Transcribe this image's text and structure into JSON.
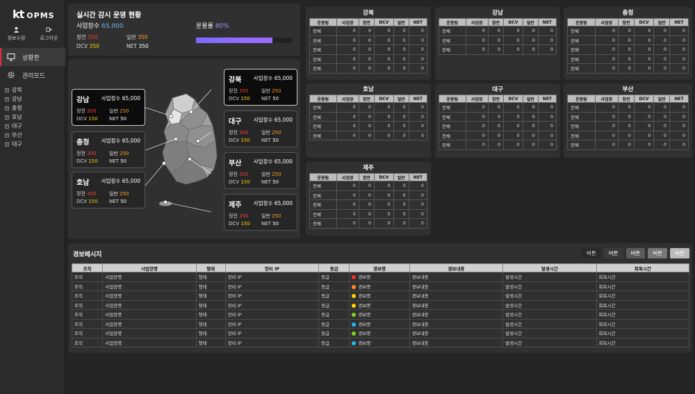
{
  "sidebar": {
    "logo": "kt",
    "app": "OPMS",
    "user_links": [
      {
        "label": "정보수정",
        "icon": "user-icon"
      },
      {
        "label": "로그아웃",
        "icon": "logout-icon"
      }
    ],
    "nav": [
      {
        "label": "상황판",
        "icon": "monitor-icon"
      },
      {
        "label": "관리모드",
        "icon": "gear-icon"
      }
    ],
    "tree": [
      "강북",
      "강남",
      "충청",
      "호남",
      "대구",
      "부산",
      "대구"
    ]
  },
  "summary": {
    "title": "실시간 감시 운영 현황",
    "count_label": "사업장수",
    "count_value": "65,000",
    "rate_label": "운용률",
    "rate_value": "80%",
    "rate": 0.8,
    "stats": {
      "outage_label": "정전",
      "outage": "350",
      "general_label": "일반",
      "general": "350",
      "dcv_label": "DCV",
      "dcv": "350",
      "net_label": "NET",
      "net": "350"
    }
  },
  "regions": [
    {
      "name": "강남",
      "count": "사업장수 65,000",
      "outage": "350",
      "general": "250",
      "dcv": "150",
      "net": "50"
    },
    {
      "name": "충청",
      "count": "사업장수 65,000",
      "outage": "350",
      "general": "250",
      "dcv": "150",
      "net": "50"
    },
    {
      "name": "호남",
      "count": "사업장수 65,000",
      "outage": "350",
      "general": "250",
      "dcv": "150",
      "net": "50"
    },
    {
      "name": "강북",
      "count": "사업장수 65,000",
      "outage": "350",
      "general": "250",
      "dcv": "150",
      "net": "50"
    },
    {
      "name": "대구",
      "count": "사업장수 65,000",
      "outage": "350",
      "general": "250",
      "dcv": "150",
      "net": "50"
    },
    {
      "name": "부산",
      "count": "사업장수 65,000",
      "outage": "350",
      "general": "250",
      "dcv": "150",
      "net": "50"
    },
    {
      "name": "제주",
      "count": "사업장수 65,000",
      "outage": "350",
      "general": "250",
      "dcv": "150",
      "net": "50"
    }
  ],
  "card_labels": {
    "outage": "정전",
    "general": "일반",
    "dcv": "DCV",
    "net": "NET"
  },
  "table_headers": [
    "운용팀",
    "사업장",
    "정전",
    "DCV",
    "일반",
    "NET"
  ],
  "region_tables": [
    {
      "title": "강북",
      "rows": [
        [
          "전체",
          "0",
          "0",
          "0",
          "0",
          "0"
        ],
        [
          "전체",
          "0",
          "0",
          "0",
          "0",
          "0"
        ],
        [
          "전체",
          "0",
          "0",
          "0",
          "0",
          "0"
        ],
        [
          "전체",
          "0",
          "0",
          "0",
          "0",
          "0"
        ],
        [
          "전체",
          "0",
          "0",
          "0",
          "0",
          "0"
        ]
      ]
    },
    {
      "title": "강남",
      "rows": [
        [
          "전체",
          "0",
          "0",
          "0",
          "0",
          "0"
        ],
        [
          "전체",
          "0",
          "0",
          "0",
          "0",
          "0"
        ],
        [
          "전체",
          "0",
          "0",
          "0",
          "0",
          "0"
        ]
      ]
    },
    {
      "title": "충청",
      "rows": [
        [
          "전체",
          "0",
          "0",
          "0",
          "0",
          "0"
        ],
        [
          "전체",
          "0",
          "0",
          "0",
          "0",
          "0"
        ],
        [
          "전체",
          "0",
          "0",
          "0",
          "0",
          "0"
        ],
        [
          "전체",
          "0",
          "0",
          "0",
          "0",
          "0"
        ],
        [
          "전체",
          "0",
          "0",
          "0",
          "0",
          "0"
        ]
      ]
    },
    {
      "title": "호남",
      "rows": [
        [
          "전체",
          "0",
          "0",
          "0",
          "0",
          "0"
        ],
        [
          "전체",
          "0",
          "0",
          "0",
          "0",
          "0"
        ],
        [
          "전체",
          "0",
          "0",
          "0",
          "0",
          "0"
        ],
        [
          "전체",
          "0",
          "0",
          "0",
          "0",
          "0"
        ]
      ]
    },
    {
      "title": "대구",
      "rows": [
        [
          "전체",
          "0",
          "0",
          "0",
          "0",
          "0"
        ],
        [
          "전체",
          "0",
          "0",
          "0",
          "0",
          "0"
        ],
        [
          "전체",
          "0",
          "0",
          "0",
          "0",
          "0"
        ],
        [
          "전체",
          "0",
          "0",
          "0",
          "0",
          "0"
        ],
        [
          "전체",
          "0",
          "0",
          "0",
          "0",
          "0"
        ]
      ]
    },
    {
      "title": "부산",
      "rows": [
        [
          "전체",
          "0",
          "0",
          "0",
          "0",
          "0"
        ],
        [
          "전체",
          "0",
          "0",
          "0",
          "0",
          "0"
        ],
        [
          "전체",
          "0",
          "0",
          "0",
          "0",
          "0"
        ],
        [
          "전체",
          "0",
          "0",
          "0",
          "0",
          "0"
        ],
        [
          "전체",
          "0",
          "0",
          "0",
          "0",
          "0"
        ]
      ]
    },
    {
      "title": "제주",
      "rows": [
        [
          "전체",
          "0",
          "0",
          "0",
          "0",
          "0"
        ],
        [
          "전체",
          "0",
          "0",
          "0",
          "0",
          "0"
        ],
        [
          "전체",
          "0",
          "0",
          "0",
          "0",
          "0"
        ],
        [
          "전체",
          "0",
          "0",
          "0",
          "0",
          "0"
        ],
        [
          "전체",
          "0",
          "0",
          "0",
          "0",
          "0"
        ]
      ]
    }
  ],
  "alarm": {
    "title": "경보메시지",
    "buttons": [
      "버튼",
      "버튼",
      "버튼",
      "버튼",
      "버튼"
    ],
    "headers": [
      "조직",
      "사업장명",
      "형태",
      "장비 IP",
      "등급",
      "경보명",
      "경보내용",
      "발생시간",
      "회복시간"
    ],
    "rows": [
      {
        "cells": [
          "조직",
          "사업장명",
          "형태",
          "장비 IP",
          "등급",
          "경보명",
          "경보내용",
          "발생시간",
          "회복시간"
        ],
        "color": "#ff2a2a"
      },
      {
        "cells": [
          "조직",
          "사업장명",
          "형태",
          "장비 IP",
          "등급",
          "경보명",
          "경보내용",
          "발생시간",
          "회복시간"
        ],
        "color": "#ff8c1a"
      },
      {
        "cells": [
          "조직",
          "사업장명",
          "형태",
          "장비 IP",
          "등급",
          "경보명",
          "경보내용",
          "발생시간",
          "회복시간"
        ],
        "color": "#ffd400"
      },
      {
        "cells": [
          "조직",
          "사업장명",
          "형태",
          "장비 IP",
          "등급",
          "경보명",
          "경보내용",
          "발생시간",
          "회복시간"
        ],
        "color": "#ffd400"
      },
      {
        "cells": [
          "조직",
          "사업장명",
          "형태",
          "장비 IP",
          "등급",
          "경보명",
          "경보내용",
          "발생시간",
          "회복시간"
        ],
        "color": "#7ed321"
      },
      {
        "cells": [
          "조직",
          "사업장명",
          "형태",
          "장비 IP",
          "등급",
          "경보명",
          "경보내용",
          "발생시간",
          "회복시간"
        ],
        "color": "#29b6f6"
      },
      {
        "cells": [
          "조직",
          "사업장명",
          "형태",
          "장비 IP",
          "등급",
          "경보명",
          "경보내용",
          "발생시간",
          "회복시간"
        ],
        "color": "#7ed321"
      },
      {
        "cells": [
          "조직",
          "사업장명",
          "형태",
          "장비 IP",
          "등급",
          "경보명",
          "경보내용",
          "발생시간",
          "회복시간"
        ],
        "color": "#29b6f6"
      }
    ]
  }
}
